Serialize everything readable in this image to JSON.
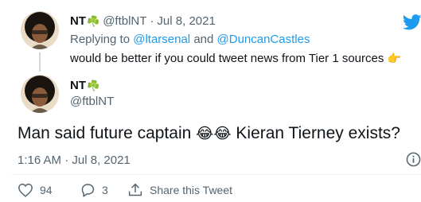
{
  "reply_tweet": {
    "display_name": "NT",
    "name_emoji": "☘️",
    "handle": "@ftblNT",
    "separator": "·",
    "date": "Jul 8, 2021",
    "replying_to_prefix": "Replying to",
    "replying_to_1": "@ltarsenal",
    "replying_to_and": "and",
    "replying_to_2": "@DuncanCastles",
    "text": "would be better if you could tweet news from Tier 1 sources",
    "text_emoji": "👉"
  },
  "main_tweet": {
    "display_name": "NT",
    "name_emoji": "☘️",
    "handle": "@ftblNT",
    "text_before": "Man said future captain",
    "text_emoji": "😂😂",
    "text_after": "Kieran Tierney exists?",
    "timestamp": "1:16 AM · Jul 8, 2021"
  },
  "actions": {
    "likes": "94",
    "replies": "3",
    "share_label": "Share this Tweet"
  },
  "icons": {
    "brand": "twitter-bird-icon",
    "info": "info-icon",
    "like": "heart-icon",
    "reply": "reply-bubble-icon",
    "share": "share-icon"
  },
  "colors": {
    "twitter_blue": "#1d9bf0",
    "muted_text": "#536471",
    "shamrock_green": "#2e9c45"
  }
}
